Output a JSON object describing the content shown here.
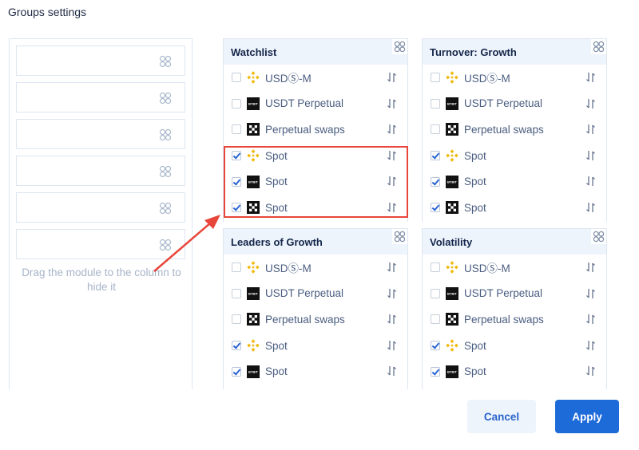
{
  "header": {
    "title": "Groups settings"
  },
  "hidden_column": {
    "slot_count": 6,
    "hint": "Drag the module to the column to hide it"
  },
  "icons": {
    "drag": "drag-handle-icon",
    "sort": "sort-arrows-icon",
    "exchanges": {
      "binance": "binance-logo-icon",
      "bybit": "bybit-logo-icon",
      "okx": "okx-logo-icon"
    }
  },
  "colors": {
    "accent": "#1d6ad9",
    "highlight": "#e8463a",
    "header_bg": "#eef4fc",
    "binance": "#f0b90b"
  },
  "groups": [
    {
      "title": "Watchlist",
      "items": [
        {
          "exchange": "binance",
          "label": "USDⓈ-M",
          "checked": false
        },
        {
          "exchange": "bybit",
          "label": "USDT Perpetual",
          "checked": false
        },
        {
          "exchange": "okx",
          "label": "Perpetual swaps",
          "checked": false
        },
        {
          "exchange": "binance",
          "label": "Spot",
          "checked": true
        },
        {
          "exchange": "bybit",
          "label": "Spot",
          "checked": true
        },
        {
          "exchange": "okx",
          "label": "Spot",
          "checked": true
        }
      ]
    },
    {
      "title": "Turnover: Growth",
      "items": [
        {
          "exchange": "binance",
          "label": "USDⓈ-M",
          "checked": false
        },
        {
          "exchange": "bybit",
          "label": "USDT Perpetual",
          "checked": false
        },
        {
          "exchange": "okx",
          "label": "Perpetual swaps",
          "checked": false
        },
        {
          "exchange": "binance",
          "label": "Spot",
          "checked": true
        },
        {
          "exchange": "bybit",
          "label": "Spot",
          "checked": true
        },
        {
          "exchange": "okx",
          "label": "Spot",
          "checked": true
        }
      ]
    },
    {
      "title": "Leaders of Growth",
      "items": [
        {
          "exchange": "binance",
          "label": "USDⓈ-M",
          "checked": false
        },
        {
          "exchange": "bybit",
          "label": "USDT Perpetual",
          "checked": false
        },
        {
          "exchange": "okx",
          "label": "Perpetual swaps",
          "checked": false
        },
        {
          "exchange": "binance",
          "label": "Spot",
          "checked": true
        },
        {
          "exchange": "bybit",
          "label": "Spot",
          "checked": true
        }
      ]
    },
    {
      "title": "Volatility",
      "items": [
        {
          "exchange": "binance",
          "label": "USDⓈ-M",
          "checked": false
        },
        {
          "exchange": "bybit",
          "label": "USDT Perpetual",
          "checked": false
        },
        {
          "exchange": "okx",
          "label": "Perpetual swaps",
          "checked": false
        },
        {
          "exchange": "binance",
          "label": "Spot",
          "checked": true
        },
        {
          "exchange": "bybit",
          "label": "Spot",
          "checked": true
        }
      ]
    }
  ],
  "footer": {
    "cancel_label": "Cancel",
    "apply_label": "Apply"
  }
}
